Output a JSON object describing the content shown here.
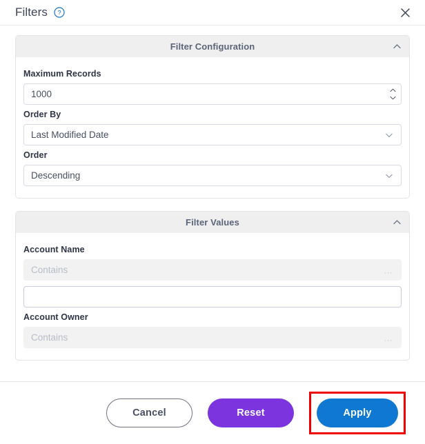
{
  "header": {
    "title": "Filters",
    "help_icon": "help-circle-icon",
    "close_icon": "close-icon"
  },
  "sections": [
    {
      "title": "Filter Configuration",
      "collapse_icon": "chevron-up-icon",
      "fields": {
        "max_records": {
          "label": "Maximum Records",
          "value": "1000",
          "spinner_up_icon": "chevron-up-icon",
          "spinner_down_icon": "chevron-down-icon"
        },
        "order_by": {
          "label": "Order By",
          "value": "Last Modified Date",
          "dropdown_icon": "chevron-down-icon"
        },
        "order": {
          "label": "Order",
          "value": "Descending",
          "dropdown_icon": "chevron-down-icon"
        }
      }
    },
    {
      "title": "Filter Values",
      "collapse_icon": "chevron-up-icon",
      "fields": {
        "account_name": {
          "label": "Account Name",
          "operator": "Contains",
          "operator_more_icon": "ellipsis-icon",
          "value": "",
          "placeholder": ""
        },
        "account_owner": {
          "label": "Account Owner",
          "operator": "Contains",
          "operator_more_icon": "ellipsis-icon"
        }
      }
    }
  ],
  "footer": {
    "cancel_label": "Cancel",
    "reset_label": "Reset",
    "apply_label": "Apply"
  },
  "colors": {
    "reset_purple": "#7b34de",
    "apply_blue": "#0f78d2",
    "annotation_red": "#ee0000",
    "section_header_bg": "#efefef",
    "section_header_text": "#5b6478",
    "help_icon_blue": "#1a73c8"
  }
}
